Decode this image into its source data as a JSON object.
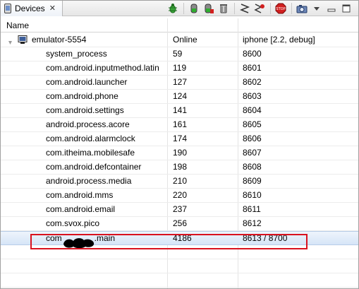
{
  "tab": {
    "label": "Devices",
    "close_glyph": "✕"
  },
  "toolbar": {
    "buttons": [
      "debug-icon",
      "update-heap-icon",
      "dump-hprof-icon",
      "cause-gc-icon",
      "update-threads-icon",
      "start-method-profiling-icon",
      "stop-process-icon",
      "screen-capture-icon",
      "view-menu-icon",
      "minimize-icon",
      "maximize-icon"
    ]
  },
  "columns": {
    "name": "Name"
  },
  "device": {
    "name": "emulator-5554",
    "status": "Online",
    "target": "iphone [2.2, debug]"
  },
  "processes": [
    {
      "name": "system_process",
      "pid": "59",
      "port": "8600"
    },
    {
      "name": "com.android.inputmethod.latin",
      "pid": "119",
      "port": "8601"
    },
    {
      "name": "com.android.launcher",
      "pid": "127",
      "port": "8602"
    },
    {
      "name": "com.android.phone",
      "pid": "124",
      "port": "8603"
    },
    {
      "name": "com.android.settings",
      "pid": "141",
      "port": "8604"
    },
    {
      "name": "android.process.acore",
      "pid": "161",
      "port": "8605"
    },
    {
      "name": "com.android.alarmclock",
      "pid": "174",
      "port": "8606"
    },
    {
      "name": "com.itheima.mobilesafe",
      "pid": "190",
      "port": "8607"
    },
    {
      "name": "com.android.defcontainer",
      "pid": "198",
      "port": "8608"
    },
    {
      "name": "android.process.media",
      "pid": "210",
      "port": "8609"
    },
    {
      "name": "com.android.mms",
      "pid": "220",
      "port": "8610"
    },
    {
      "name": "com.android.email",
      "pid": "237",
      "port": "8611"
    },
    {
      "name": "com.svox.pico",
      "pid": "256",
      "port": "8612"
    },
    {
      "name_prefix": "com",
      "name_suffix": ".main",
      "pid": "4186",
      "port": "8613 / 8700",
      "selected": true
    }
  ],
  "colors": {
    "highlight": "#d9121f",
    "selection": "#d6e5f7"
  }
}
